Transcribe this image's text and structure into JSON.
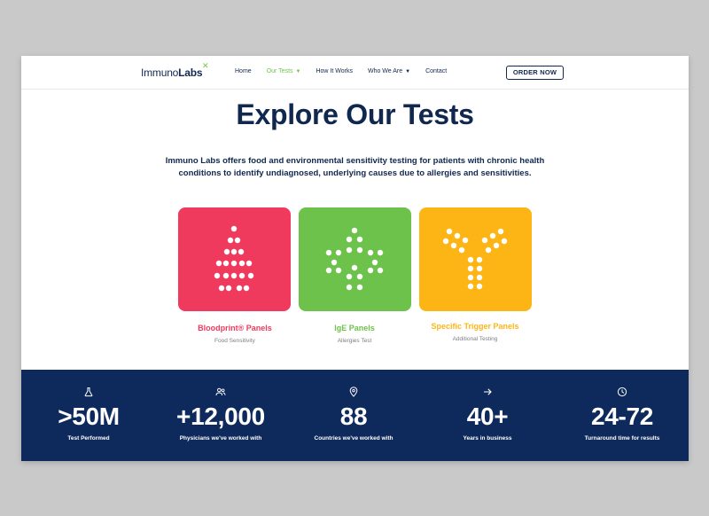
{
  "header": {
    "logo_light": "Immuno",
    "logo_bold": "Labs",
    "nav": [
      {
        "label": "Home",
        "has_caret": false,
        "active": false
      },
      {
        "label": "Our Tests",
        "has_caret": true,
        "active": true
      },
      {
        "label": "How It Works",
        "has_caret": false,
        "active": false
      },
      {
        "label": "Who We Are",
        "has_caret": true,
        "active": false
      },
      {
        "label": "Contact",
        "has_caret": false,
        "active": false
      }
    ],
    "order_label": "ORDER NOW"
  },
  "hero": {
    "title": "Explore Our Tests",
    "intro": "Immuno Labs offers food and environmental sensitivity testing for patients with chronic health conditions to identify undiagnosed, underlying causes due to allergies and sensitivities."
  },
  "panels": [
    {
      "title": "Bloodprint® Panels",
      "subtitle": "Food Sensitivity",
      "color": "#ef3a5d",
      "icon": "droplet-dots-icon"
    },
    {
      "title": "IgE Panels",
      "subtitle": "Allergies Test",
      "color": "#6cc24a",
      "icon": "cross-dots-icon"
    },
    {
      "title": "Specific Trigger Panels",
      "subtitle": "Additional Testing",
      "color": "#fdb515",
      "icon": "antibody-dots-icon"
    }
  ],
  "stats": [
    {
      "value": ">50M",
      "label": "Test Performed",
      "icon": "flask-icon"
    },
    {
      "value": "+12,000",
      "label": "Physicians we've worked with",
      "icon": "users-icon"
    },
    {
      "value": "88",
      "label": "Countries we've worked with",
      "icon": "location-pin-icon"
    },
    {
      "value": "40+",
      "label": "Years in business",
      "icon": "arrow-right-icon"
    },
    {
      "value": "24-72",
      "label": "Turnaround time for results",
      "icon": "clock-icon"
    }
  ],
  "colors": {
    "navy": "#10284f",
    "stats_bg": "#0e2a5c",
    "green": "#71c44b",
    "red": "#ef3a5d",
    "yellow": "#fdb515"
  }
}
